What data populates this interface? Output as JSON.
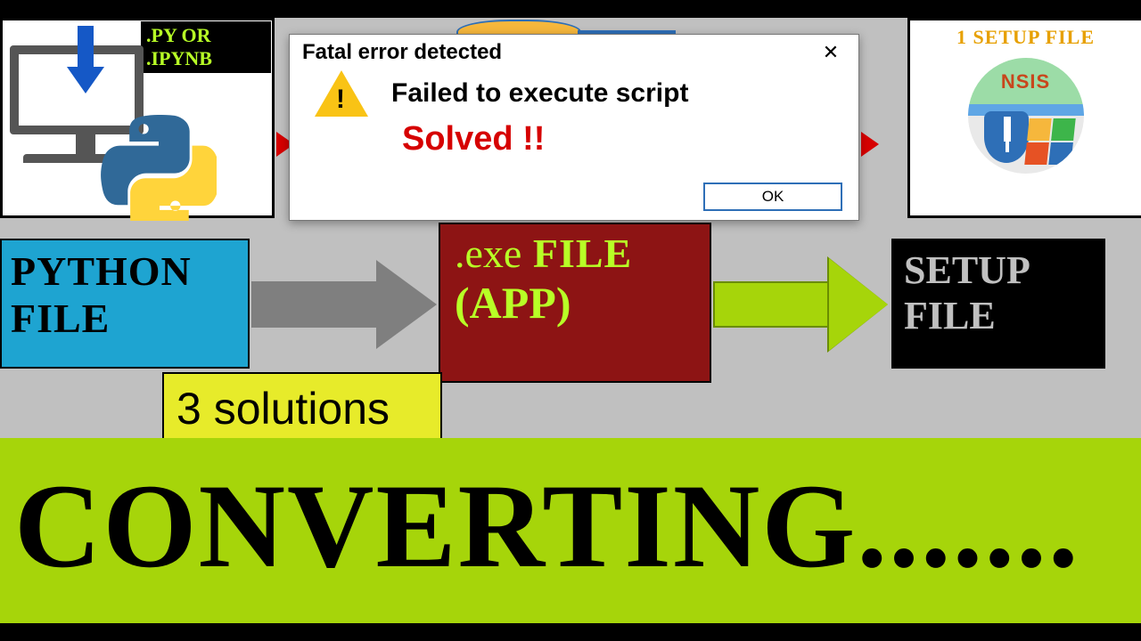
{
  "top": {
    "pyornb": ".PY OR .IPYNB",
    "setup_label": "1 SETUP FILE",
    "nsis": "NSIS"
  },
  "dialog": {
    "title": "Fatal error detected",
    "close_glyph": "✕",
    "message": "Failed to execute script",
    "solved": "Solved !!",
    "ok": "OK"
  },
  "boxes": {
    "python_l1": "PYTHON",
    "python_l2": "FILE",
    "exe_l1_a": ".exe",
    "exe_l1_b": " FILE",
    "exe_l2": "(APP)",
    "setup_l1": "SETUP",
    "setup_l2": "FILE",
    "solutions": "3 solutions"
  },
  "bottom": {
    "converting": "CONVERTING......."
  }
}
